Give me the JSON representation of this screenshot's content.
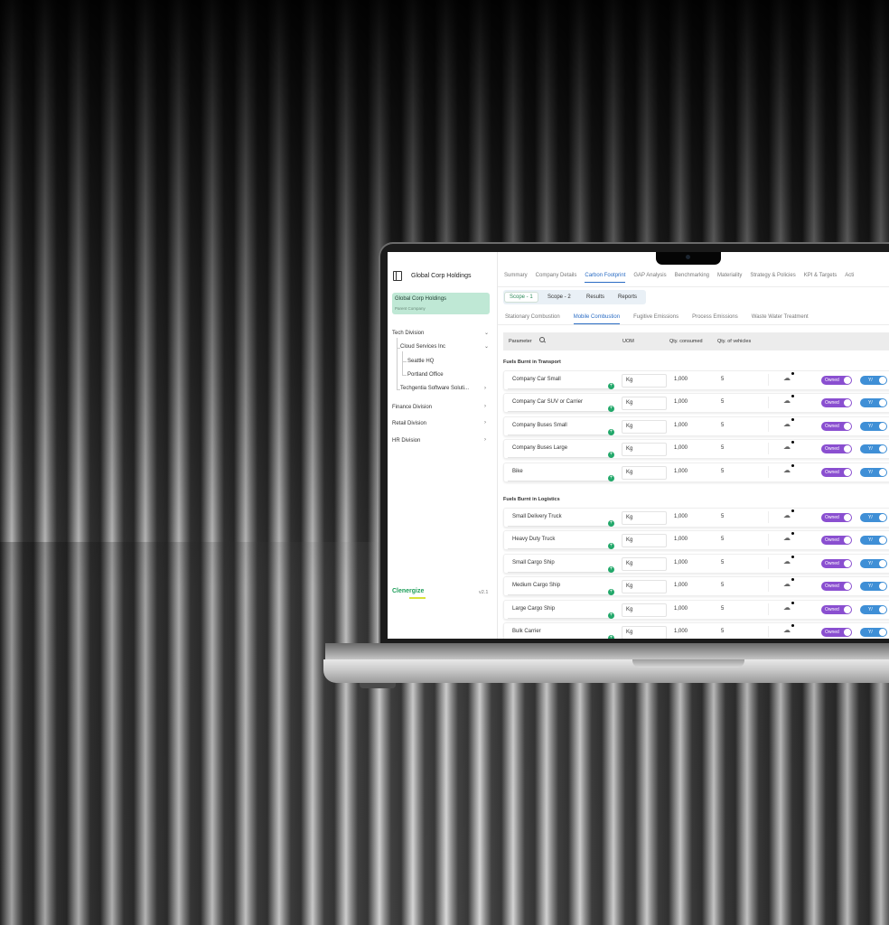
{
  "app": {
    "org_title": "Global Corp Holdings",
    "company_card": {
      "name": "Global Corp Holdings",
      "subtitle": "Parent Company"
    },
    "logo": "Clenergize",
    "version": "v2.1"
  },
  "sidebar": {
    "tree": [
      {
        "label": "Tech Division"
      },
      {
        "label": "Cloud Services Inc"
      },
      {
        "label": "Seattle HQ"
      },
      {
        "label": "Portland Office"
      },
      {
        "label": "Techgentia Software Soluti..."
      },
      {
        "label": "Finance Division"
      },
      {
        "label": "Retail Division"
      },
      {
        "label": "HR Division"
      }
    ]
  },
  "tabs": [
    "Summary",
    "Company Details",
    "Carbon Footprint",
    "GAP Analysis",
    "Benchmarking",
    "Materiality",
    "Strategy & Policies",
    "KPI & Targets",
    "Acti"
  ],
  "active_tab": "Carbon Footprint",
  "scopes": [
    "Scope - 1",
    "Scope - 2",
    "Results",
    "Reports"
  ],
  "subtabs": [
    "Stationary Combustion",
    "Mobile Combustion",
    "Fugitive Emissions",
    "Process Emissions",
    "Waste Water Treatment"
  ],
  "table": {
    "headers": {
      "parameter": "Parameter",
      "uom": "UOM",
      "qty": "Qty. consumed",
      "vehicles": "Qty. of vehicles"
    },
    "sections": [
      {
        "title": "Fuels Burnt in Transport",
        "rows": [
          {
            "name": "Company Car Small",
            "uom": "Kg",
            "qty": "1,000",
            "vehicles": "5",
            "ownership": "Owned",
            "toggle": "Y/"
          },
          {
            "name": "Company Car SUV or Carrier",
            "uom": "Kg",
            "qty": "1,000",
            "vehicles": "5",
            "ownership": "Owned",
            "toggle": "Y/"
          },
          {
            "name": "Company Buses Small",
            "uom": "Kg",
            "qty": "1,000",
            "vehicles": "5",
            "ownership": "Owned",
            "toggle": "Y/"
          },
          {
            "name": "Company Buses Large",
            "uom": "Kg",
            "qty": "1,000",
            "vehicles": "5",
            "ownership": "Owned",
            "toggle": "Y/"
          },
          {
            "name": "Bike",
            "uom": "Kg",
            "qty": "1,000",
            "vehicles": "5",
            "ownership": "Owned",
            "toggle": "Y/"
          }
        ]
      },
      {
        "title": "Fuels Burnt in Logistics",
        "rows": [
          {
            "name": "Small Delivery Truck",
            "uom": "Kg",
            "qty": "1,000",
            "vehicles": "5",
            "ownership": "Owned",
            "toggle": "Y/"
          },
          {
            "name": "Heavy Duty Truck",
            "uom": "Kg",
            "qty": "1,000",
            "vehicles": "5",
            "ownership": "Owned",
            "toggle": "Y/"
          },
          {
            "name": "Small Cargo Ship",
            "uom": "Kg",
            "qty": "1,000",
            "vehicles": "5",
            "ownership": "Owned",
            "toggle": "Y/"
          },
          {
            "name": "Medium Cargo Ship",
            "uom": "Kg",
            "qty": "1,000",
            "vehicles": "5",
            "ownership": "Owned",
            "toggle": "Y/"
          },
          {
            "name": "Large Cargo Ship",
            "uom": "Kg",
            "qty": "1,000",
            "vehicles": "5",
            "ownership": "Owned",
            "toggle": "Y/"
          },
          {
            "name": "Bulk Carrier",
            "uom": "Kg",
            "qty": "1,000",
            "vehicles": "5",
            "ownership": "Owned",
            "toggle": "Y/"
          }
        ]
      }
    ]
  },
  "colors": {
    "accent_blue": "#2a6cc4",
    "brand_green": "#1e9e5a",
    "company_card": "#bfe8d5",
    "owned_pill": "#8a4fd0",
    "toggle_on": "#3f8fd6"
  },
  "icons": [
    "panel-icon",
    "search-icon",
    "chevron-down-icon",
    "chevron-right-icon",
    "plus-icon",
    "cloud-upload-icon"
  ]
}
